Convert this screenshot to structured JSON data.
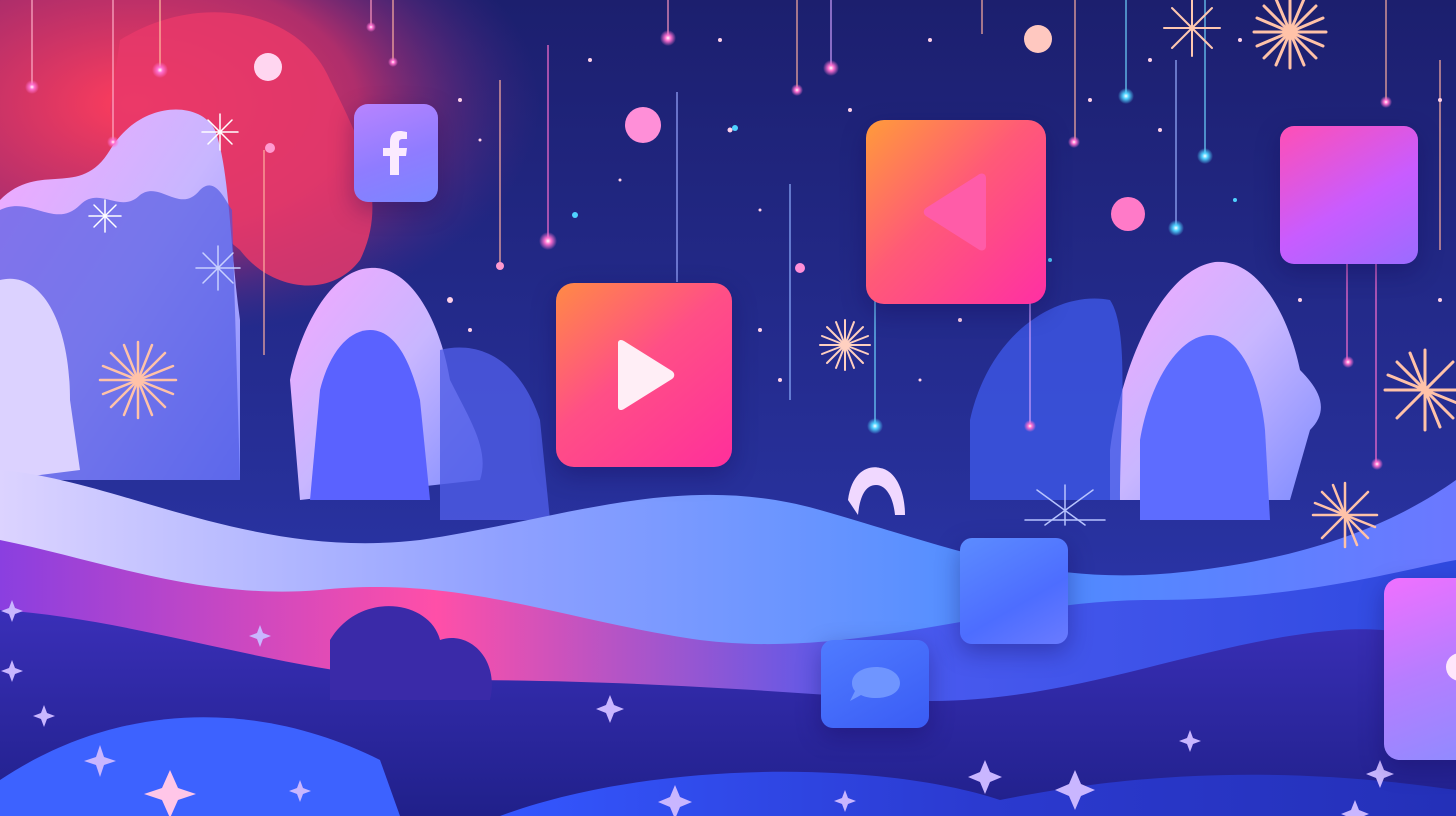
{
  "scene": {
    "tiles": [
      {
        "name": "facebook-tile",
        "icon": "facebook-icon"
      },
      {
        "name": "play-tile",
        "icon": "play-icon"
      },
      {
        "name": "back-tile",
        "icon": "rewind-arrow-icon"
      },
      {
        "name": "blank-tile-right",
        "icon": "none"
      },
      {
        "name": "blank-tile-blue",
        "icon": "none"
      },
      {
        "name": "chat-tile",
        "icon": "chat-bubble-icon"
      },
      {
        "name": "edge-tile",
        "icon": "none"
      }
    ],
    "colors": {
      "sky_top": "#1c1f6e",
      "sky_left_glow": "#e63a5a",
      "wave_blue": "#3f6bff",
      "wave_pink": "#ff4fa8",
      "tile_pink": "#ff3d8f",
      "tile_orange": "#ff9a40",
      "tile_violet": "#b884ff",
      "star_glow": "#ffb7a3"
    }
  }
}
